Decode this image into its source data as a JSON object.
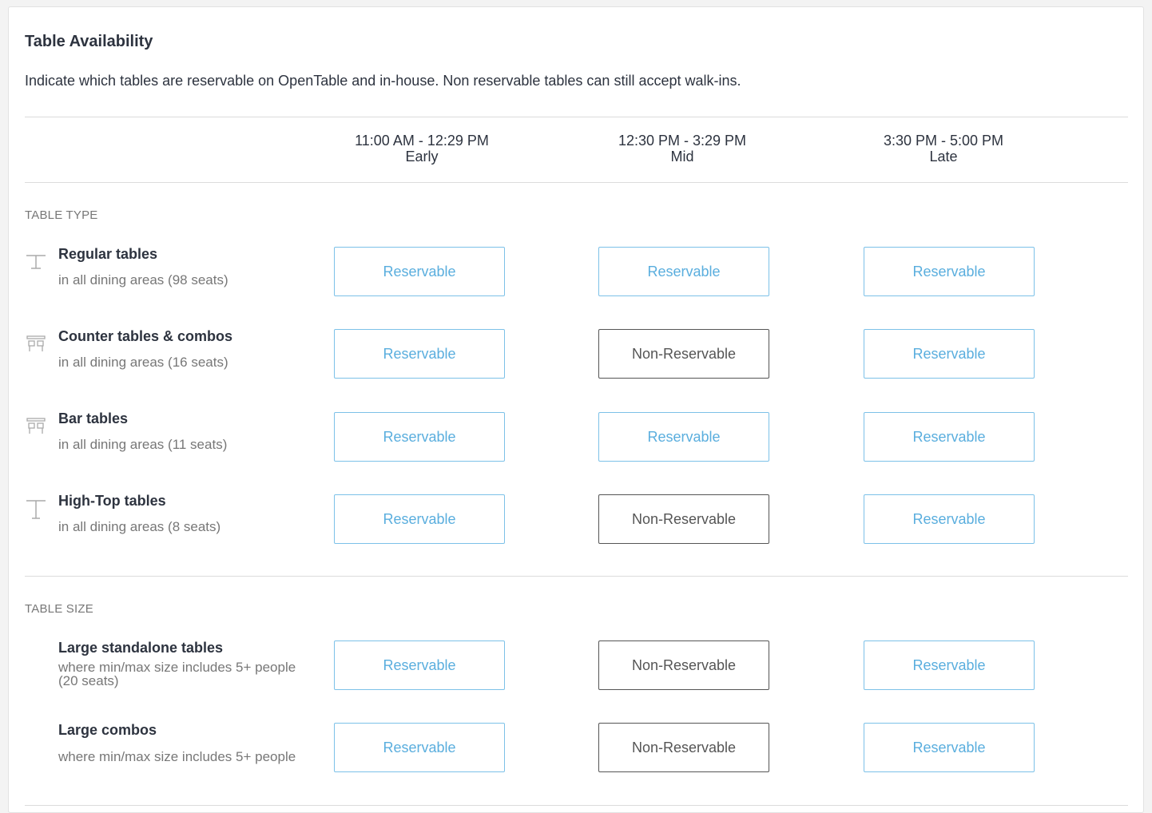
{
  "title": "Table Availability",
  "description": "Indicate which tables are reservable on OpenTable and in-house. Non reservable tables can still accept walk-ins.",
  "columns": [
    {
      "time": "11:00 AM - 12:29 PM",
      "name": "Early"
    },
    {
      "time": "12:30 PM - 3:29 PM",
      "name": "Mid"
    },
    {
      "time": "3:30 PM - 5:00 PM",
      "name": "Late"
    }
  ],
  "sections": {
    "table_type": {
      "label": "TABLE TYPE",
      "rows": [
        {
          "icon": "regular-table-icon",
          "name": "Regular tables",
          "sub": "in all dining areas (98 seats)",
          "states": [
            "Reservable",
            "Reservable",
            "Reservable"
          ]
        },
        {
          "icon": "counter-table-icon",
          "name": "Counter tables & combos",
          "sub": "in all dining areas (16 seats)",
          "states": [
            "Reservable",
            "Non-Reservable",
            "Reservable"
          ]
        },
        {
          "icon": "bar-table-icon",
          "name": "Bar tables",
          "sub": "in all dining areas (11 seats)",
          "states": [
            "Reservable",
            "Reservable",
            "Reservable"
          ]
        },
        {
          "icon": "high-top-table-icon",
          "name": "High-Top tables",
          "sub": "in all dining areas (8 seats)",
          "states": [
            "Reservable",
            "Non-Reservable",
            "Reservable"
          ]
        }
      ]
    },
    "table_size": {
      "label": "TABLE SIZE",
      "rows": [
        {
          "name": "Large standalone tables",
          "sub": "where min/max size includes 5+ people",
          "sub2": "(20 seats)",
          "states": [
            "Reservable",
            "Non-Reservable",
            "Reservable"
          ]
        },
        {
          "name": "Large combos",
          "sub": "where min/max size includes 5+ people",
          "states": [
            "Reservable",
            "Non-Reservable",
            "Reservable"
          ]
        }
      ]
    }
  },
  "colors": {
    "reservable": "#5aaede",
    "non_reservable": "#555555"
  }
}
